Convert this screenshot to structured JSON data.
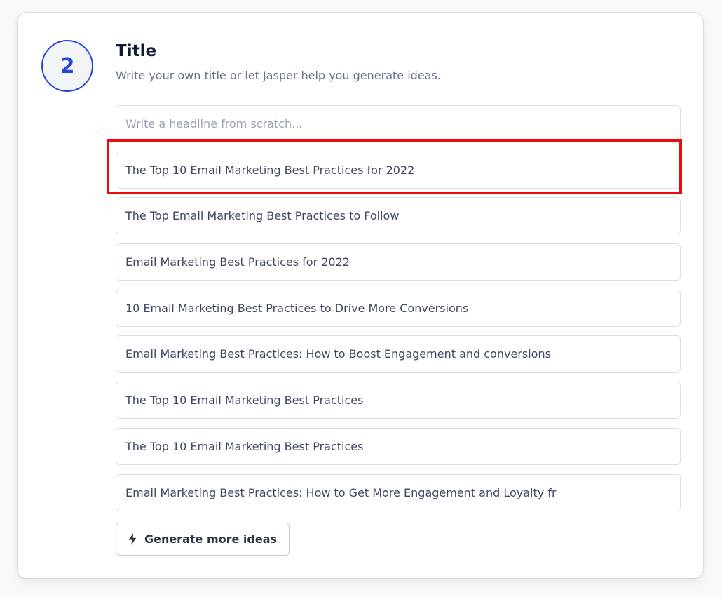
{
  "step": {
    "number": "2"
  },
  "header": {
    "title": "Title",
    "subtitle": "Write your own title or let Jasper help you generate ideas."
  },
  "headline_input": {
    "placeholder": "Write a headline from scratch...",
    "value": ""
  },
  "ideas": [
    "The Top 10 Email Marketing Best Practices for 2022",
    "The Top Email Marketing Best Practices to Follow",
    "Email Marketing Best Practices for 2022",
    "10 Email Marketing Best Practices to Drive More Conversions",
    "Email Marketing Best Practices: How to Boost Engagement and conversions",
    "The Top 10 Email Marketing Best Practices",
    "The Top 10 Email Marketing Best Practices",
    "Email Marketing Best Practices: How to Get More Engagement and Loyalty fr"
  ],
  "actions": {
    "generate_label": "Generate more ideas",
    "generate_icon": "lightning-bolt-icon"
  },
  "colors": {
    "accent": "#2446e0",
    "highlight": "#ee0a0a",
    "text": "#3f4860",
    "heading": "#0f1a33"
  }
}
